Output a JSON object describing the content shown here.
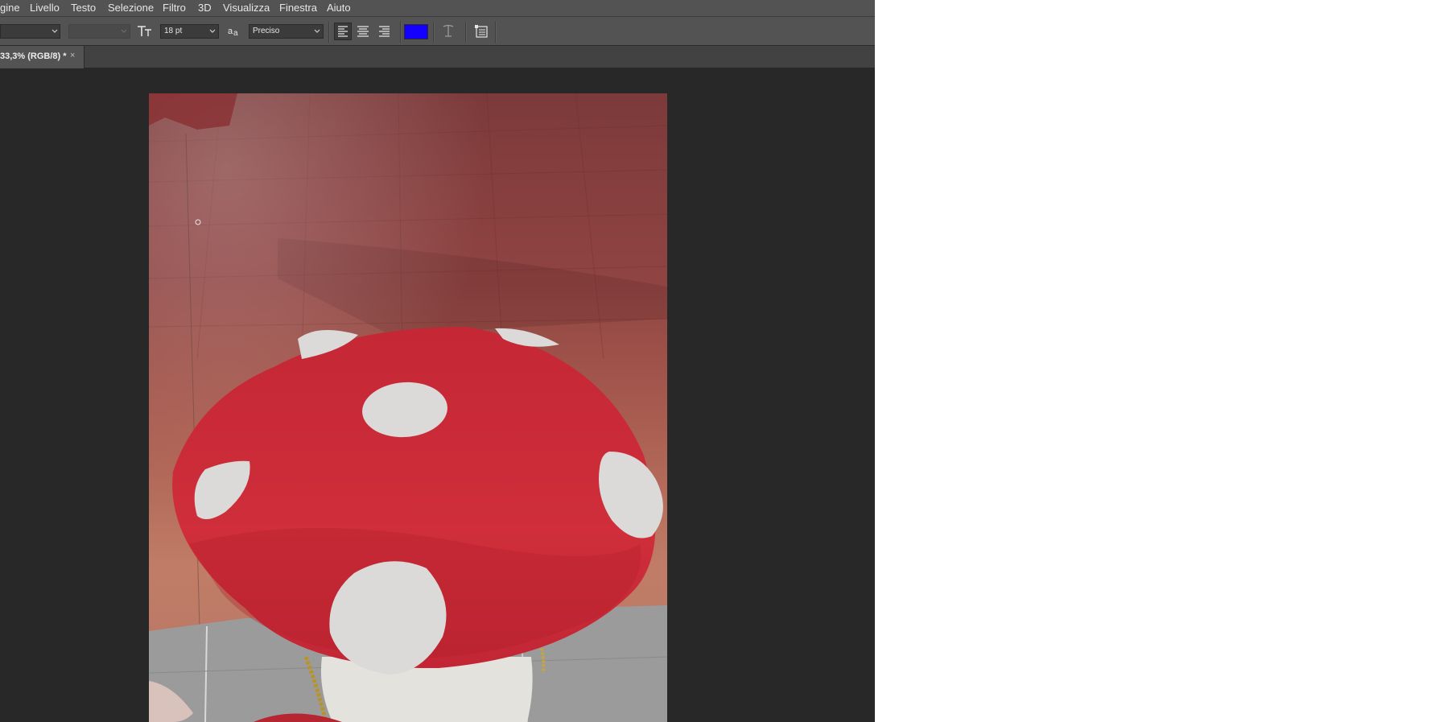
{
  "menu": {
    "items": [
      "gine",
      "Livello",
      "Testo",
      "Selezione",
      "Filtro",
      "3D",
      "Visualizza",
      "Finestra",
      "Aiuto"
    ]
  },
  "options_bar": {
    "font_size": "18 pt",
    "antialias": "Preciso",
    "text_color": "#1400ff",
    "icons": [
      "text-orientation-icon",
      "antialias-icon",
      "align-left-icon",
      "align-center-icon",
      "align-right-icon",
      "warp-text-icon",
      "character-panel-icon"
    ]
  },
  "document_tab": {
    "title": "33,3% (RGB/8) *",
    "close": "×"
  },
  "canvas": {
    "subject": "red-mushroom-hat-photo",
    "colors": {
      "cap": "#c82a35",
      "spots": "#dcdad8",
      "floor": "#8e3e3c"
    }
  }
}
